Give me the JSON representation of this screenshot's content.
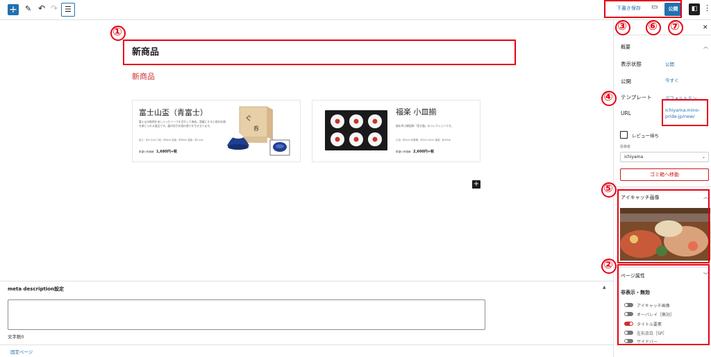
{
  "toolbar": {
    "add_icon": "plus-icon",
    "draft_label": "下書き保存",
    "publish_label": "公開"
  },
  "editor": {
    "title": "新商品",
    "subheading": "新商品"
  },
  "products": [
    {
      "name": "富士山盃（青富士）",
      "description": "富士山の絵柄をあしらったリーフを活かして焼成。酒器にする土地の伝統を感じられる逸品です。器の形がお酒の香りを引き立てます。",
      "spec": "高さ：約4.5cm 口径：約8cm 容量：約80ml 重量：約110g",
      "price_label": "希望小売価格",
      "price": "1,680円+税"
    },
    {
      "name": "福楽 小皿揃",
      "description": "福を呼ぶ縁起物「招き猫」のコレクションです。",
      "spec": "小皿：約9cm 化粧箱：約24×15cm 重量：約390g",
      "price_label": "希望小売価格",
      "price": "2,600円+税"
    }
  ],
  "meta_box": {
    "title": "meta description設定",
    "textarea_value": "",
    "count_label": "文字数0",
    "fixed_page_link": "固定ページ"
  },
  "sidebar": {
    "summary_heading": "概要",
    "visibility_label": "表示状態",
    "visibility_value": "公開",
    "publish_label": "公開",
    "publish_value": "今すぐ",
    "template_label": "テンプレート",
    "template_value": "デフォルトテン...",
    "url_label": "URL",
    "url_value": "ichiyama.mino-pride.jp/new/",
    "review_label": "レビュー待ち",
    "author_label": "投稿者",
    "author_value": "ichiyama",
    "trash_label": "ゴミ箱へ移動",
    "eyecatch_heading": "アイキャッチ画像",
    "page_attr_heading": "ページ属性",
    "hide_heading": "非表示・無効",
    "toggles": [
      {
        "label": "アイキャッチ画像",
        "on": false
      },
      {
        "label": "オーバレイ［無効］",
        "on": false
      },
      {
        "label": "タイトル要素",
        "on": true
      },
      {
        "label": "左右余白［SP］",
        "on": false
      },
      {
        "label": "サイドバー",
        "on": false
      }
    ]
  },
  "annotations": [
    "①",
    "②",
    "③",
    "④",
    "⑤",
    "⑥",
    "⑦"
  ],
  "colors": {
    "accent": "#2271b1",
    "annotation_red": "#e60012",
    "subheading_red": "#cf2e2e"
  }
}
